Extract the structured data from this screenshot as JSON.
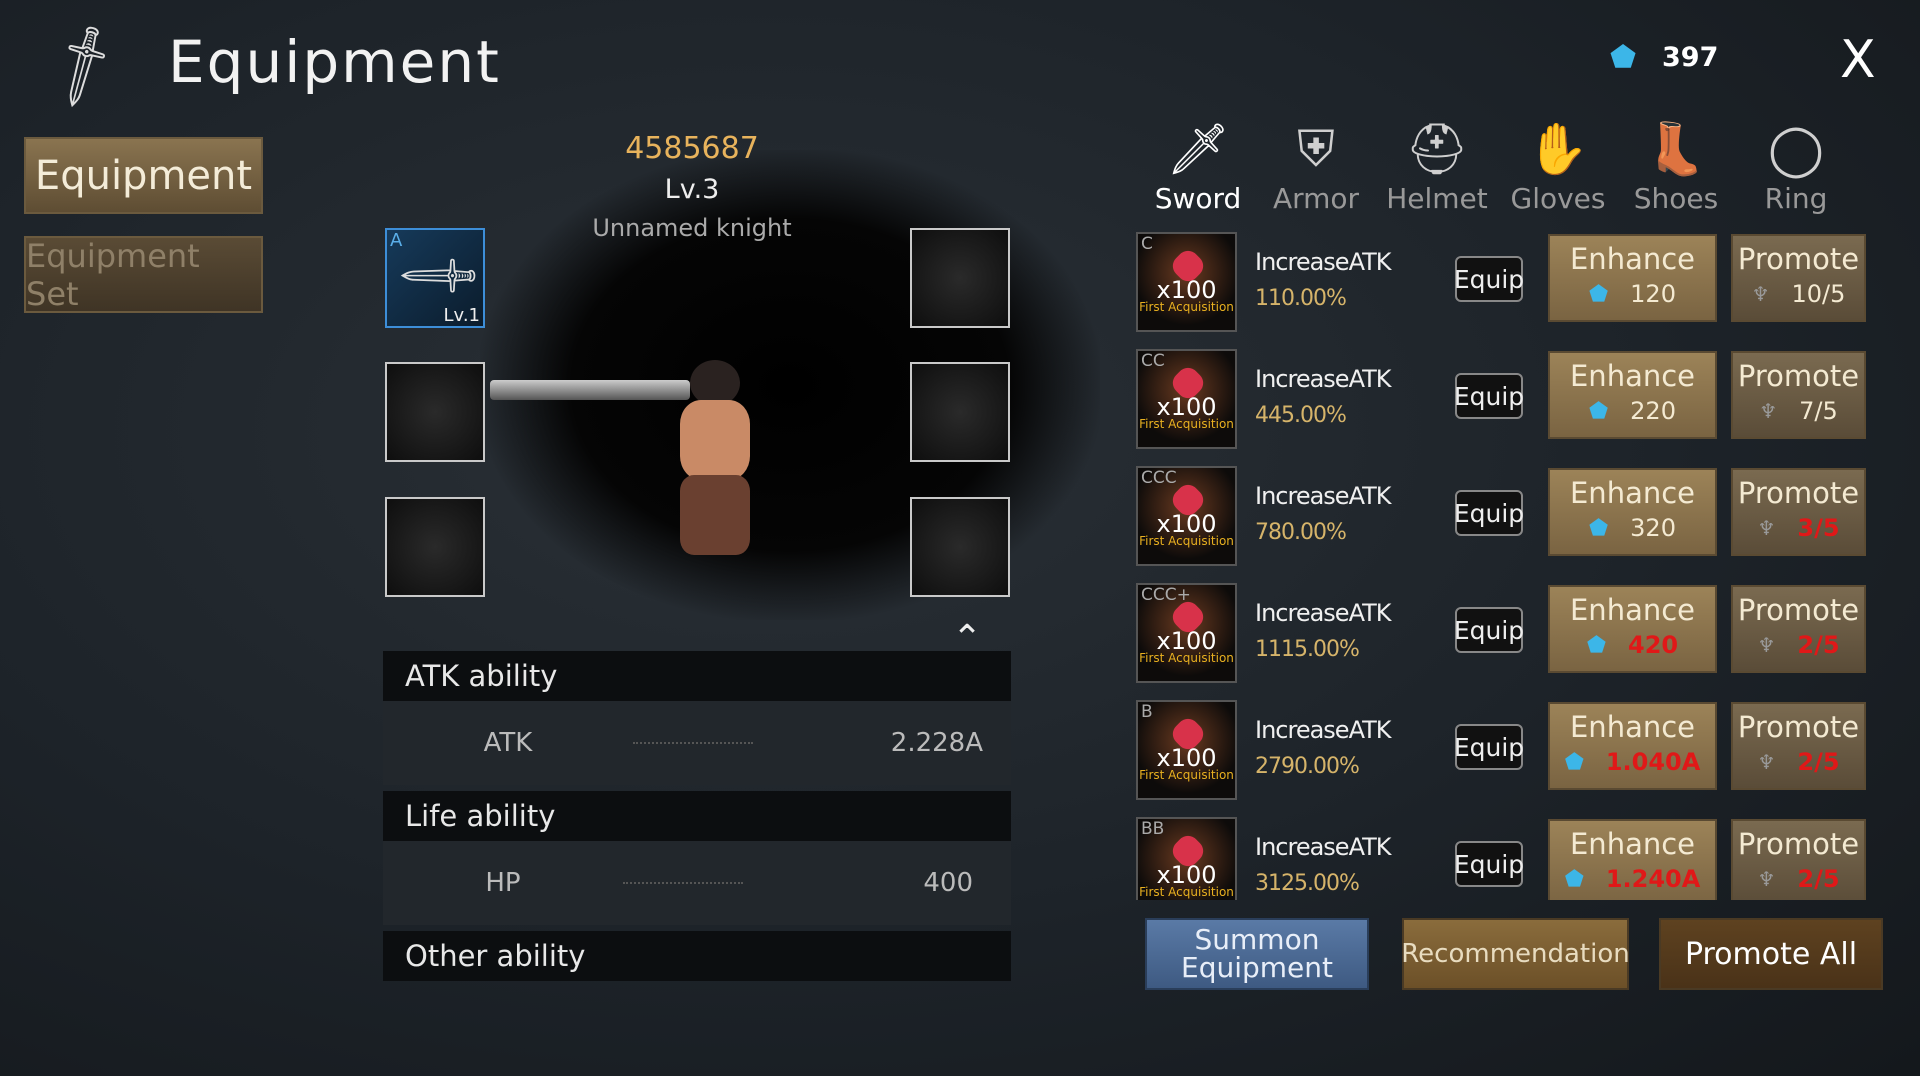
{
  "header": {
    "title": "Equipment",
    "currency_icon": "blue-gem-icon",
    "currency": "397",
    "close": "X"
  },
  "left_tabs": [
    "Equipment",
    "Equipment Set"
  ],
  "character": {
    "power": "4585687",
    "level": "Lv.3",
    "name": "Unnamed knight",
    "equipped_slot": {
      "grade": "A",
      "level": "Lv.1"
    }
  },
  "stats": {
    "atk_header": "ATK ability",
    "atk_label": "ATK",
    "atk_value": "2.228A",
    "life_header": "Life ability",
    "hp_label": "HP",
    "hp_value": "400",
    "other_header": "Other ability"
  },
  "tabs": [
    {
      "label": "Sword",
      "icon": "sword-icon"
    },
    {
      "label": "Armor",
      "icon": "armor-icon"
    },
    {
      "label": "Helmet",
      "icon": "helmet-icon"
    },
    {
      "label": "Gloves",
      "icon": "gloves-icon"
    },
    {
      "label": "Shoes",
      "icon": "shoes-icon"
    },
    {
      "label": "Ring",
      "icon": "ring-icon"
    }
  ],
  "list": [
    {
      "grade": "C",
      "qty": "x100",
      "tag": "First Acquisition",
      "name": "IncreaseATK",
      "pct": "110.00%",
      "enh": "120",
      "enh_red": false,
      "pro": "10/5",
      "pro_red": false
    },
    {
      "grade": "CC",
      "qty": "x100",
      "tag": "First Acquisition",
      "name": "IncreaseATK",
      "pct": "445.00%",
      "enh": "220",
      "enh_red": false,
      "pro": "7/5",
      "pro_red": false
    },
    {
      "grade": "CCC",
      "qty": "x100",
      "tag": "First Acquisition",
      "name": "IncreaseATK",
      "pct": "780.00%",
      "enh": "320",
      "enh_red": false,
      "pro": "3/5",
      "pro_red": true
    },
    {
      "grade": "CCC+",
      "qty": "x100",
      "tag": "First Acquisition",
      "name": "IncreaseATK",
      "pct": "1115.00%",
      "enh": "420",
      "enh_red": true,
      "pro": "2/5",
      "pro_red": true
    },
    {
      "grade": "B",
      "qty": "x100",
      "tag": "First Acquisition",
      "name": "IncreaseATK",
      "pct": "2790.00%",
      "enh": "1.040A",
      "enh_red": true,
      "pro": "2/5",
      "pro_red": true
    },
    {
      "grade": "BB",
      "qty": "x100",
      "tag": "First Acquisition",
      "name": "IncreaseATK",
      "pct": "3125.00%",
      "enh": "1.240A",
      "enh_red": true,
      "pro": "2/5",
      "pro_red": true
    }
  ],
  "labels": {
    "equip": "Equip",
    "enhance": "Enhance",
    "promote": "Promote"
  },
  "bottom": {
    "summon": "Summon Equipment",
    "recommend": "Recommendation",
    "promote_all": "Promote All"
  }
}
